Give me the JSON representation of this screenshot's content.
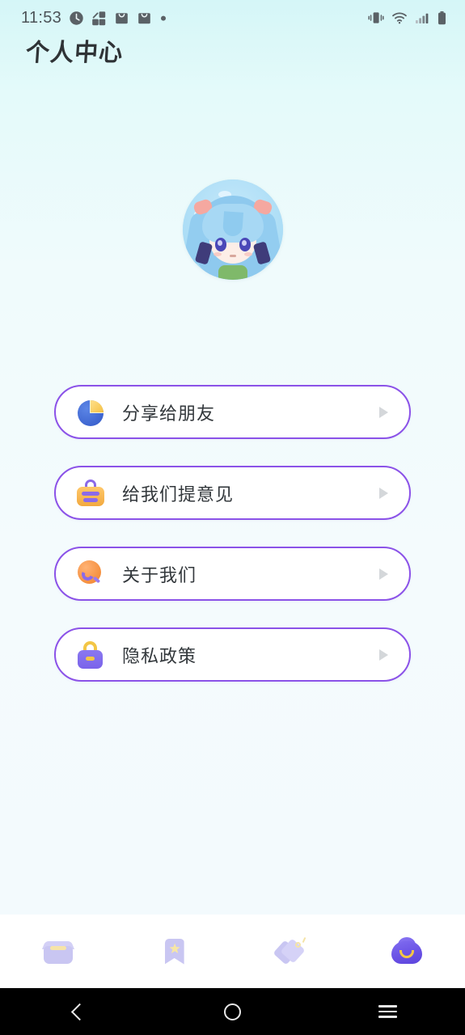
{
  "statusbar": {
    "time": "11:53",
    "left_icons": [
      "alarm-icon",
      "share-network-icon",
      "notification-bag-icon",
      "notification-bag-icon",
      "dot-icon"
    ],
    "right_icons": [
      "vibrate-icon",
      "wifi-icon",
      "signal-icon",
      "battery-icon"
    ]
  },
  "header": {
    "title": "个人中心"
  },
  "profile": {
    "avatar_name": "user-avatar",
    "avatar_alt": "anime-character-blue-hair"
  },
  "menu": {
    "items": [
      {
        "label": "分享给朋友",
        "icon": "share-pie-icon",
        "arrow": "chevron-right-icon"
      },
      {
        "label": "给我们提意见",
        "icon": "feedback-board-icon",
        "arrow": "chevron-right-icon"
      },
      {
        "label": "关于我们",
        "icon": "about-magnifier-icon",
        "arrow": "chevron-right-icon"
      },
      {
        "label": "隐私政策",
        "icon": "lock-icon",
        "arrow": "chevron-right-icon"
      }
    ]
  },
  "tabbar": {
    "tabs": [
      {
        "name": "inbox",
        "icon": "inbox-tray-icon",
        "active": false
      },
      {
        "name": "favorites",
        "icon": "bookmark-star-icon",
        "active": false
      },
      {
        "name": "tags",
        "icon": "price-tags-icon",
        "active": false
      },
      {
        "name": "profile",
        "icon": "cloud-profile-icon",
        "active": true
      }
    ]
  },
  "navbar": {
    "back": "back-icon",
    "home": "home-icon",
    "recents": "recents-icon"
  },
  "colors": {
    "accent_purple": "#8b52e8",
    "active_tab": "#6950e4",
    "inactive_tab": "#c9c6f2",
    "bg_top": "#d5f6f7",
    "bg_bottom": "#f2fafc",
    "text": "#33383c"
  }
}
